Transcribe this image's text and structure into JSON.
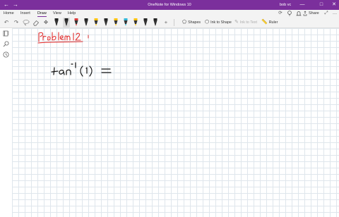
{
  "titlebar": {
    "back_glyph": "←",
    "forward_glyph": "→",
    "title": "OneNote for Windows 10",
    "user": "bob vc",
    "minimize_glyph": "—",
    "maximize_glyph": "□",
    "close_glyph": "✕",
    "background": "#7b2f9c"
  },
  "ribbon": {
    "tabs": [
      "Home",
      "Insert",
      "Draw",
      "View",
      "Help"
    ],
    "active_tab": "Draw",
    "share_label": "Share",
    "icons": [
      "sync-icon",
      "lightbulb-icon",
      "bell-icon",
      "share-icon",
      "expand-icon",
      "more-icon"
    ],
    "icon_glyphs": [
      "⟳",
      "♀",
      "🔔",
      "",
      "⤢",
      "…"
    ]
  },
  "toolbar": {
    "tool_icons": [
      "undo-icon",
      "redo-icon",
      "lasso-icon",
      "eraser-icon",
      "pan-icon"
    ],
    "tool_glyphs": [
      "↶",
      "↷",
      "◌",
      "⌫",
      "✥"
    ],
    "pen_colors": [
      "#222222",
      "#222222",
      "#d83b3b",
      "#222222",
      "#ffc107",
      "#222222",
      "#ffc107",
      "#2fb5d6",
      "#ffc107",
      "#222222",
      "#222222"
    ],
    "selected_pen_index": 1,
    "add_pen_glyph": "+",
    "shapes_label": "Shapes",
    "ink_to_shape_label": "Ink to Shape",
    "ink_to_text_label": "Ink to Text",
    "ruler_label": "Ruler"
  },
  "sidebar": {
    "icons": [
      "notebooks-icon",
      "search-icon",
      "recent-icon"
    ],
    "glyphs": [
      "☰",
      "⌕",
      "◷"
    ]
  },
  "canvas": {
    "handwriting": [
      "Problem 12",
      "tan⁻¹(1) ="
    ],
    "ink_colors": {
      "title": "#e03030",
      "body": "#111111"
    }
  }
}
